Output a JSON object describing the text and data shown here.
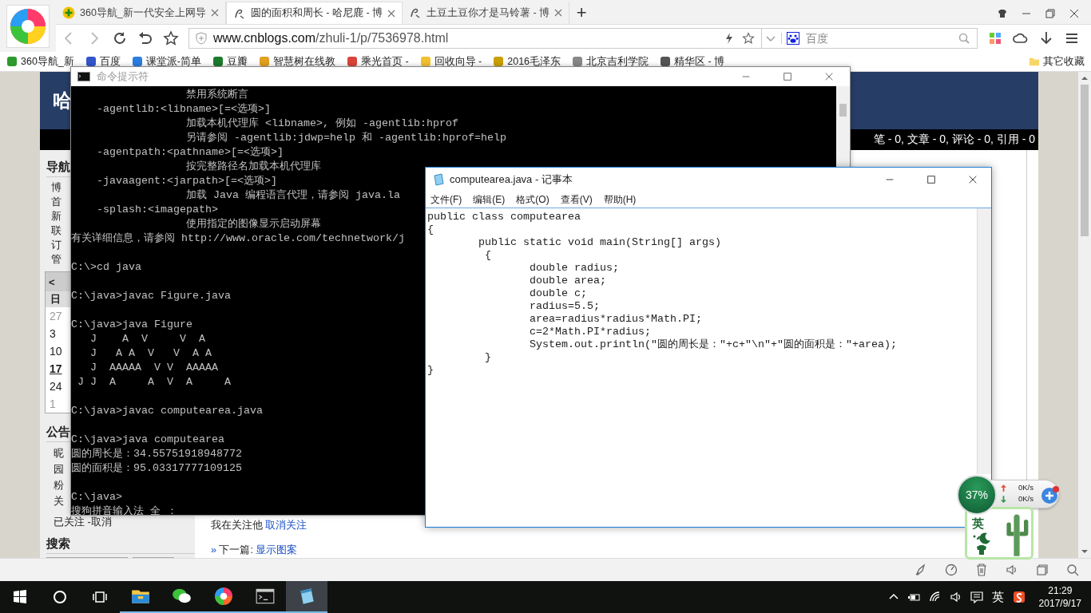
{
  "browser": {
    "tabs": [
      {
        "title": "360导航_新一代安全上网导",
        "selected": false
      },
      {
        "title": "圆的面积和周长 - 哈尼鹿 - 博",
        "selected": true
      },
      {
        "title": "土豆土豆你才是马铃薯 - 博",
        "selected": false
      }
    ],
    "new_tab": "+",
    "address": {
      "host": "www.cnblogs.com",
      "path": "/zhuli-1/p/7536978.html"
    },
    "search": {
      "placeholder": "百度"
    },
    "bookmarks": [
      "360导航_新",
      "百度",
      "课堂派-简单",
      "豆瓣",
      "智慧树在线教",
      "乘光首页 -",
      "回收向导 -",
      "2016毛泽东",
      "北京吉利学院",
      "精华区 - 博"
    ],
    "other_bookmarks": "其它收藏"
  },
  "blog": {
    "header_title": "哈",
    "stats": "笔 - 0, 文章 - 0, 评论 - 0, 引用 - 0",
    "nav_heading": "导航",
    "nav_items": [
      "博",
      "首",
      "新",
      "联",
      "订",
      "管"
    ],
    "calendar": {
      "prev": "<",
      "weekday": "日",
      "days": [
        {
          "day": "27",
          "today": false,
          "other_month": true
        },
        {
          "day": "3",
          "today": false,
          "other_month": false
        },
        {
          "day": "10",
          "today": false,
          "other_month": false
        },
        {
          "day": "17",
          "today": true,
          "other_month": false
        },
        {
          "day": "24",
          "today": false,
          "other_month": false
        },
        {
          "day": "1",
          "today": false,
          "other_month": true
        }
      ]
    },
    "notice_heading": "公告",
    "notice_items": [
      "昵",
      "园",
      "粉",
      "关"
    ],
    "followed": "已关注 -取消",
    "search_heading": "搜索",
    "follow_text": "我在关注他",
    "unfollow_link": "取消关注",
    "next_marker": "»",
    "next_label": "下一篇:",
    "next_link": "显示图案"
  },
  "cmd": {
    "title": "命令提示符",
    "blocks": [
      [
        "                  禁用系统断言",
        "    -agentlib:<libname>[=<选项>]",
        "                  加载本机代理库 <libname>, 例如 -agentlib:hprof",
        "                  另请参阅 -agentlib:jdwp=help 和 -agentlib:hprof=help",
        "    -agentpath:<pathname>[=<选项>]",
        "                  按完整路径名加载本机代理库",
        "    -javaagent:<jarpath>[=<选项>]",
        "                  加载 Java 编程语言代理，请参阅 java.la",
        "    -splash:<imagepath>",
        "                  使用指定的图像显示启动屏幕",
        "有关详细信息，请参阅 http://www.oracle.com/technetwork/j"
      ],
      [
        "C:\\>cd java"
      ],
      [
        "C:\\java>javac Figure.java"
      ],
      [
        "C:\\java>java Figure",
        "   J    A  V     V  A",
        "   J   A A  V   V  A A",
        "   J  AAAAA  V V  AAAAA",
        " J J  A     A  V  A     A"
      ],
      [
        "C:\\java>javac computearea.java"
      ],
      [
        "C:\\java>java computearea",
        "圆的周长是：34.55751918948772",
        "圆的面积是：95.03317777109125"
      ],
      [
        "C:\\java>",
        "搜狗拼音输入法 全 ："
      ]
    ]
  },
  "notepad": {
    "title": "computearea.java - 记事本",
    "menu": [
      "文件(F)",
      "编辑(E)",
      "格式(O)",
      "查看(V)",
      "帮助(H)"
    ],
    "lines": [
      "public class computearea",
      "{",
      "        public static void main(String[] args)",
      "         {",
      "                double radius;",
      "                double area;",
      "                double c;",
      "                radius=5.5;",
      "                area=radius*radius*Math.PI;",
      "                c=2*Math.PI*radius;",
      "                System.out.println(\"圆的周长是：\"+c+\"\\n\"+\"圆的面积是：\"+area);",
      "         }",
      "}"
    ]
  },
  "widget": {
    "percent": "37%",
    "upload": "0K/s",
    "download": "0K/s",
    "ime": "英"
  },
  "taskbar": {
    "apps": [
      {
        "kind": "explorer",
        "running": true,
        "selected": false
      },
      {
        "kind": "wechat",
        "running": true,
        "selected": false
      },
      {
        "kind": "browser",
        "running": true,
        "selected": false
      },
      {
        "kind": "console",
        "running": true,
        "selected": false
      },
      {
        "kind": "notepad",
        "running": true,
        "selected": true
      }
    ],
    "ime": "英",
    "time": "21:29",
    "date": "2017/9/17"
  }
}
